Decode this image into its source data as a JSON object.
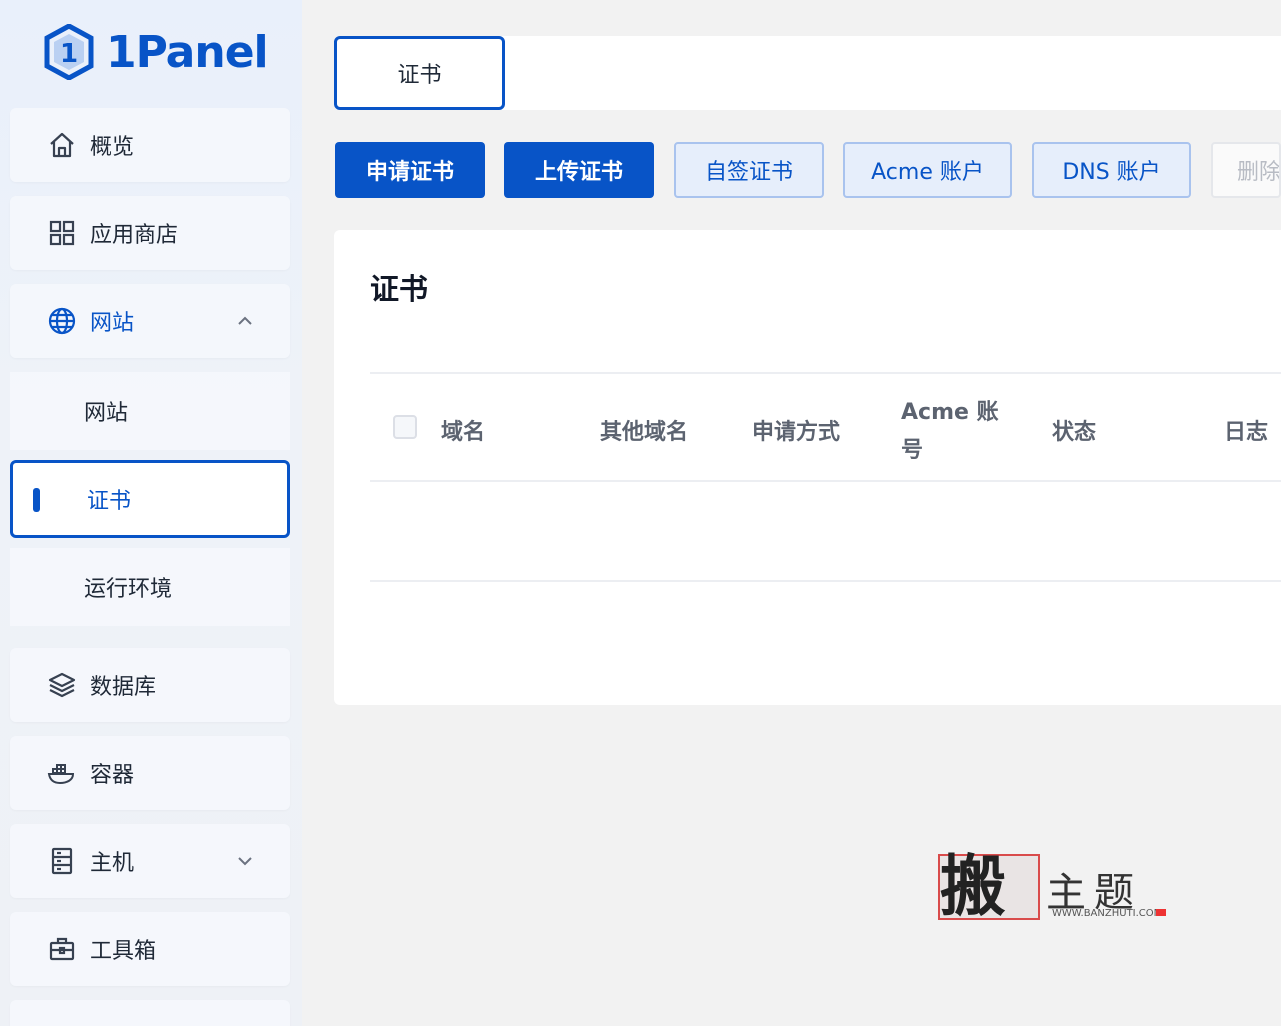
{
  "app": {
    "logo_text": "1Panel",
    "accent_color": "#0854c7"
  },
  "sidebar": {
    "items": [
      {
        "label": "概览",
        "icon": "home-icon"
      },
      {
        "label": "应用商店",
        "icon": "grid-icon"
      },
      {
        "label": "网站",
        "icon": "globe-icon",
        "expanded": true
      },
      {
        "label": "数据库",
        "icon": "layers-icon"
      },
      {
        "label": "容器",
        "icon": "docker-icon"
      },
      {
        "label": "主机",
        "icon": "server-icon",
        "expanded": false
      },
      {
        "label": "工具箱",
        "icon": "toolbox-icon"
      }
    ],
    "website_children": [
      {
        "label": "网站"
      },
      {
        "label": "证书",
        "selected": true
      },
      {
        "label": "运行环境"
      }
    ]
  },
  "tabs": {
    "active_label": "证书"
  },
  "toolbar": {
    "apply_cert": "申请证书",
    "upload_cert": "上传证书",
    "self_signed": "自签证书",
    "acme_account": "Acme 账户",
    "dns_account": "DNS 账户",
    "delete": "删除"
  },
  "card": {
    "title": "证书",
    "columns": [
      "域名",
      "其他域名",
      "申请方式",
      "Acme 账号",
      "状态",
      "日志"
    ]
  },
  "watermark": {
    "big_char": "搬",
    "chars": "主题",
    "url": "WWW.BANZHUTI.COM"
  }
}
